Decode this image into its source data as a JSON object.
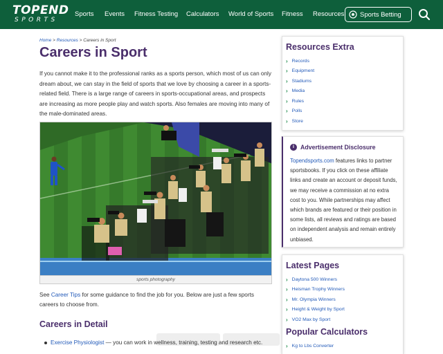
{
  "header": {
    "logo_top": "TOPEND",
    "logo_bottom": "SPORTS",
    "nav": [
      "Sports",
      "Events",
      "Fitness Testing",
      "Calculators",
      "World of Sports",
      "Fitness",
      "Resources"
    ],
    "betting_label": "Sports Betting",
    "bg_color": "#0e5f3b"
  },
  "breadcrumb": {
    "home": "Home",
    "sep1": " > ",
    "resources": "Resources",
    "sep2": " > ",
    "current": "Careers in Sport"
  },
  "page": {
    "title": "Careers in Sport",
    "intro": "If you cannot make it to the professional ranks as a sports person, which most of us can only dream about, we can stay in the field of sports that we love by choosing a career in a sports-related field. There is a large range of careers in sports-occupational areas, and prospects are increasing as more people play and watch sports. Also females are moving into many of the male-dominated areas.",
    "photo_caption": "sports photography",
    "see_prefix": "See ",
    "see_link": "Career Tips",
    "see_suffix": " for some guidance to find the job for you. Below are just a few sports careers to choose from.",
    "section_title": "Careers in Detail",
    "list_link": "Exercise Physiologist",
    "list_text": " — you can work in wellness, training, testing and research etc."
  },
  "sidebar": {
    "resources_title": "Resources Extra",
    "resources_links": [
      "Records",
      "Equipment",
      "Stadiums",
      "Media",
      "Rules",
      "Polls",
      "Store"
    ],
    "adv_title": "Advertisement Disclosure",
    "adv_link": "Topendsports.com",
    "adv_text": " features links to partner sportsbooks. If you click on these affiliate links and create an account or deposit funds, we may receive a commission at no extra cost to you. While partnerships may affect which brands are featured or their position in some lists, all reviews and ratings are based on independent analysis and remain entirely unbiased.",
    "latest_title": "Latest Pages",
    "latest_links": [
      "Daytona 500 Winners",
      "Heisman Trophy Winners",
      "Mr. Olympia Winners",
      "Height & Weight by Sport",
      "VO2 Max by Sport"
    ],
    "calc_title": "Popular Calculators",
    "calc_links": [
      "Kg to Lbs Converter"
    ]
  },
  "colors": {
    "accent_purple": "#4a2e6b",
    "link_blue": "#2159b8",
    "chevron_green": "#1f8a4c"
  }
}
